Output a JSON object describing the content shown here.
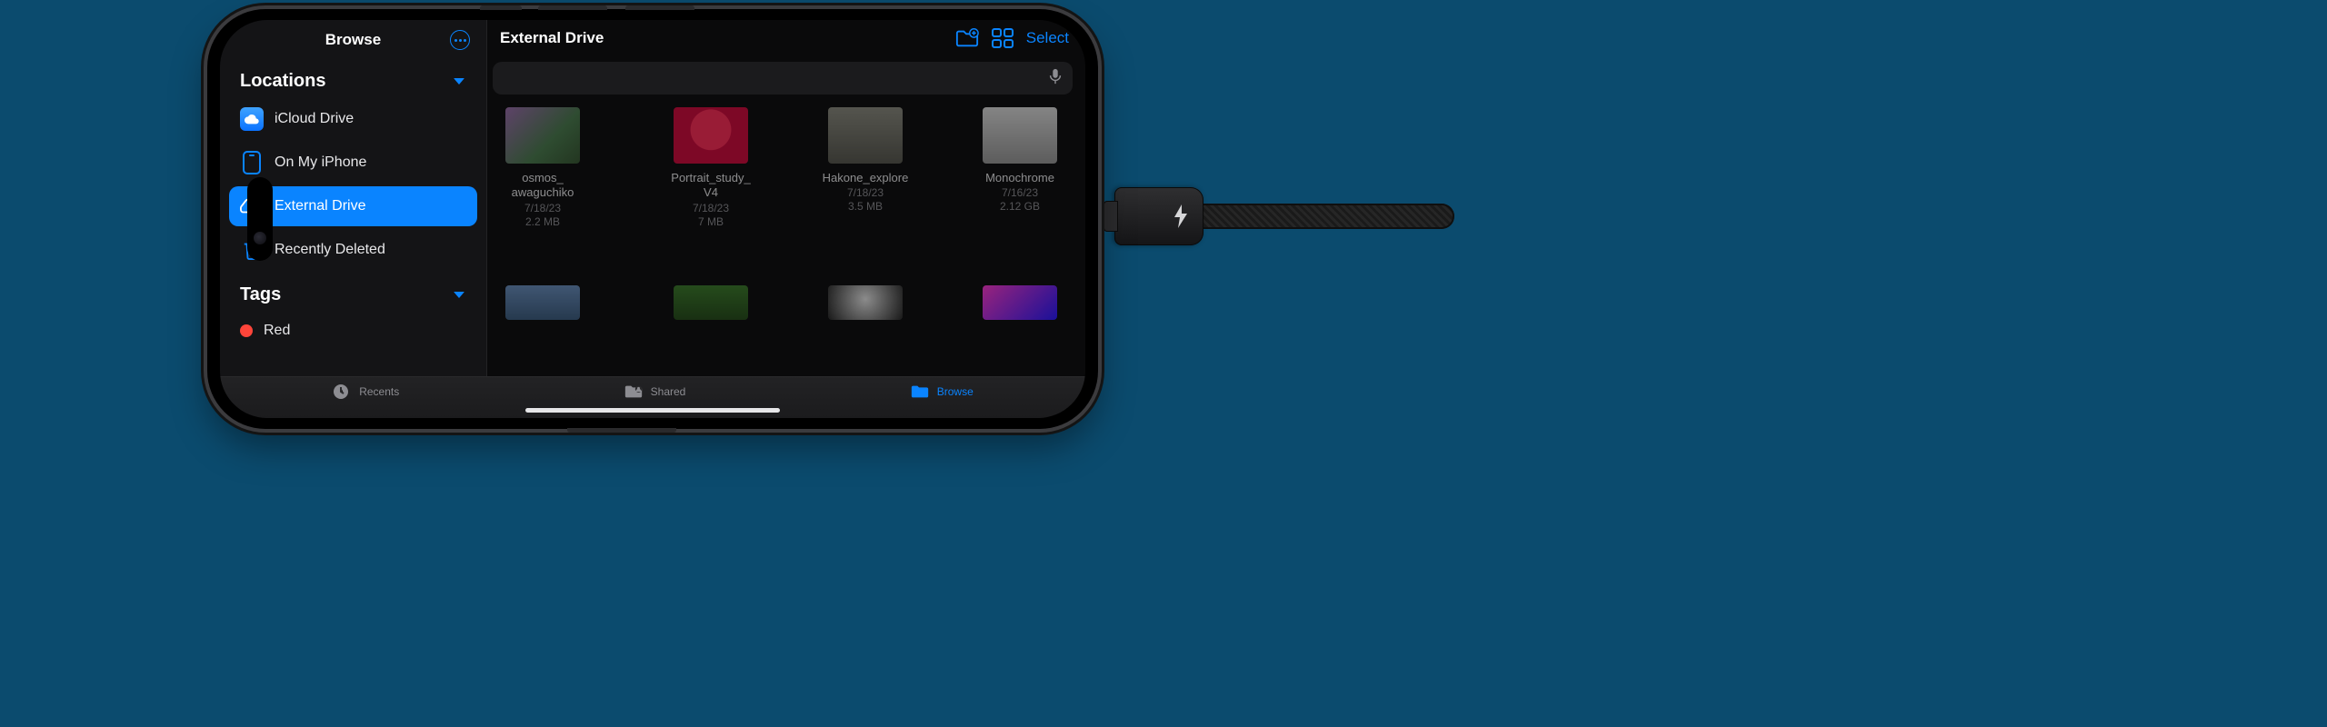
{
  "sidebar": {
    "title": "Browse",
    "sections": {
      "locations": {
        "title": "Locations",
        "items": [
          {
            "label": "iCloud Drive"
          },
          {
            "label": "On My iPhone"
          },
          {
            "label": "External Drive",
            "selected": true
          },
          {
            "label": "Recently Deleted"
          }
        ]
      },
      "tags": {
        "title": "Tags",
        "items": [
          {
            "label": "Red",
            "color": "#ff453a"
          }
        ]
      }
    }
  },
  "main": {
    "title": "External Drive",
    "select_label": "Select",
    "files": [
      {
        "name_line1": "osmos_",
        "name_line2": "awaguchiko",
        "date": "7/18/23",
        "size": "2.2 MB"
      },
      {
        "name_line1": "Portrait_study_",
        "name_line2": "V4",
        "date": "7/18/23",
        "size": "7 MB"
      },
      {
        "name_line1": "Hakone_explore",
        "name_line2": "",
        "date": "7/18/23",
        "size": "3.5 MB"
      },
      {
        "name_line1": "Monochrome",
        "name_line2": "",
        "date": "7/16/23",
        "size": "2.12 GB"
      }
    ]
  },
  "tabbar": {
    "recents": "Recents",
    "shared": "Shared",
    "browse": "Browse"
  },
  "colors": {
    "accent": "#0a84ff"
  }
}
